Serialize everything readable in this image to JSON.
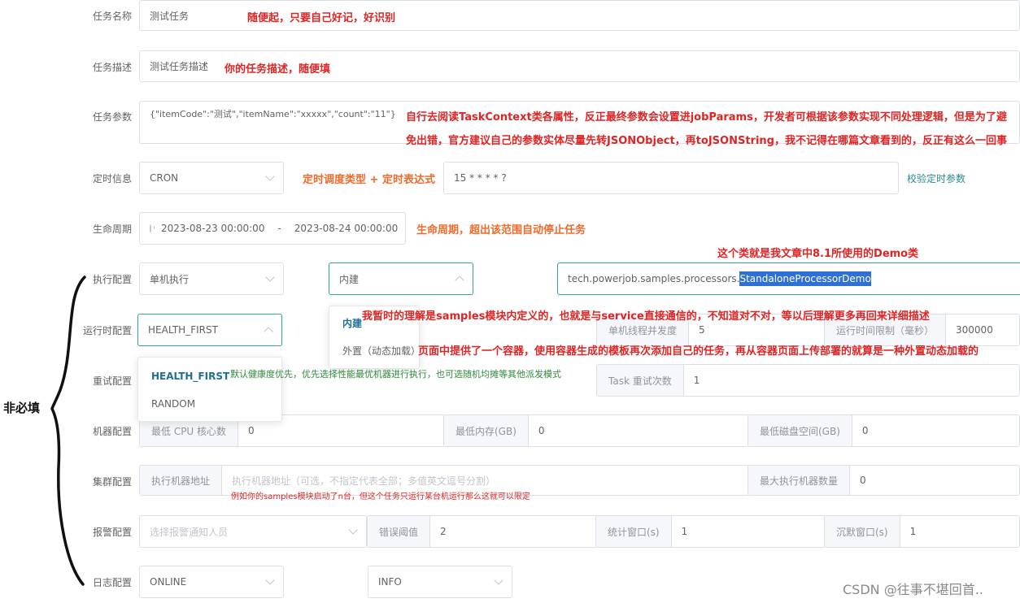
{
  "rows": {
    "task_name": {
      "label": "任务名称",
      "value": "测试任务",
      "note": "随便起，只要自己好记，好识别"
    },
    "task_desc": {
      "label": "任务描述",
      "value": "测试任务描述",
      "note": "你的任务描述，随便填"
    },
    "task_params": {
      "label": "任务参数",
      "value": "{\"itemCode\":\"测试\",\"itemName\":\"xxxxx\",\"count\":\"11\"}",
      "note_line1": "自行去阅读TaskContext类各属性，反正最终参数会设置进jobParams，开发者可根据该参数实现不同处理逻辑，但是为了避",
      "note_line2": "免出错，官方建议自己的参数实体尽量先转JSONObject，再toJSONString，我不记得在哪篇文章看到的，反正有这么一回事"
    },
    "schedule": {
      "label": "定时信息",
      "type": "CRON",
      "note": "定时调度类型 + 定时表达式",
      "expression": "15 * * * * ?",
      "validate_link": "校验定时参数"
    },
    "lifecycle": {
      "label": "生命周期",
      "start": "2023-08-23 00:00:00",
      "separator": "-",
      "end": "2023-08-24 00:00:00",
      "note": "生命周期，超出该范围自动停止任务"
    },
    "execution": {
      "label": "执行配置",
      "mode": "单机执行",
      "processor_type": "内建",
      "processor_prefix": "tech.powerjob.samples.processors.",
      "processor_highlight": "StandaloneProcessorDemo",
      "note_class": "这个类就是我文章中8.1所使用的Demo类",
      "note_builtin": "我暂时的理解是samples模块内定义的，也就是与service直接通信的，不知道对不对，等以后理解更多再回来详细描述",
      "note_external": "页面中提供了一个容器，使用容器生成的模板再次添加自己的任务，再从容器页面上传部署的就算是一种外置动态加载的",
      "type_options": [
        "内建",
        "外置（动态加载）"
      ]
    },
    "runtime": {
      "label": "运行时配置",
      "dispatch": "HEALTH_FIRST",
      "dispatch_options": [
        "HEALTH_FIRST",
        "RANDOM"
      ],
      "note_dispatch": "默认健康度优先，优先选择性能最优机器进行执行，也可选随机均摊等其他派发模式",
      "concurrency_label": "单机线程并发度",
      "concurrency": "5",
      "timeout_label": "运行时间限制（毫秒）",
      "timeout": "300000"
    },
    "retry": {
      "label": "重试配置",
      "task_retry_label": "Task 重试次数",
      "task_retry": "1"
    },
    "machine": {
      "label": "机器配置",
      "cpu_label": "最低 CPU 核心数",
      "cpu": "0",
      "mem_label": "最低内存(GB)",
      "mem": "0",
      "disk_label": "最低磁盘空间(GB)",
      "disk": "0"
    },
    "cluster": {
      "label": "集群配置",
      "addr_label": "执行机器地址",
      "addr_placeholder": "执行机器地址（可选，不指定代表全部；多值英文逗号分割）",
      "max_label": "最大执行机器数量",
      "max": "0",
      "note": "例如你的samples模块启动了n台，但这个任务只运行某台机运行那么这就可以限定"
    },
    "alarm": {
      "label": "报警配置",
      "receiver_placeholder": "选择报警通知人员",
      "threshold_label": "错误阈值",
      "threshold": "2",
      "window_label": "统计窗口(s)",
      "window": "1",
      "silence_label": "沉默窗口(s)",
      "silence": "1"
    },
    "log": {
      "label": "日志配置",
      "type": "ONLINE",
      "level": "INFO"
    }
  },
  "side_note": "非必填",
  "watermark": "CSDN @往事不堪回首.."
}
